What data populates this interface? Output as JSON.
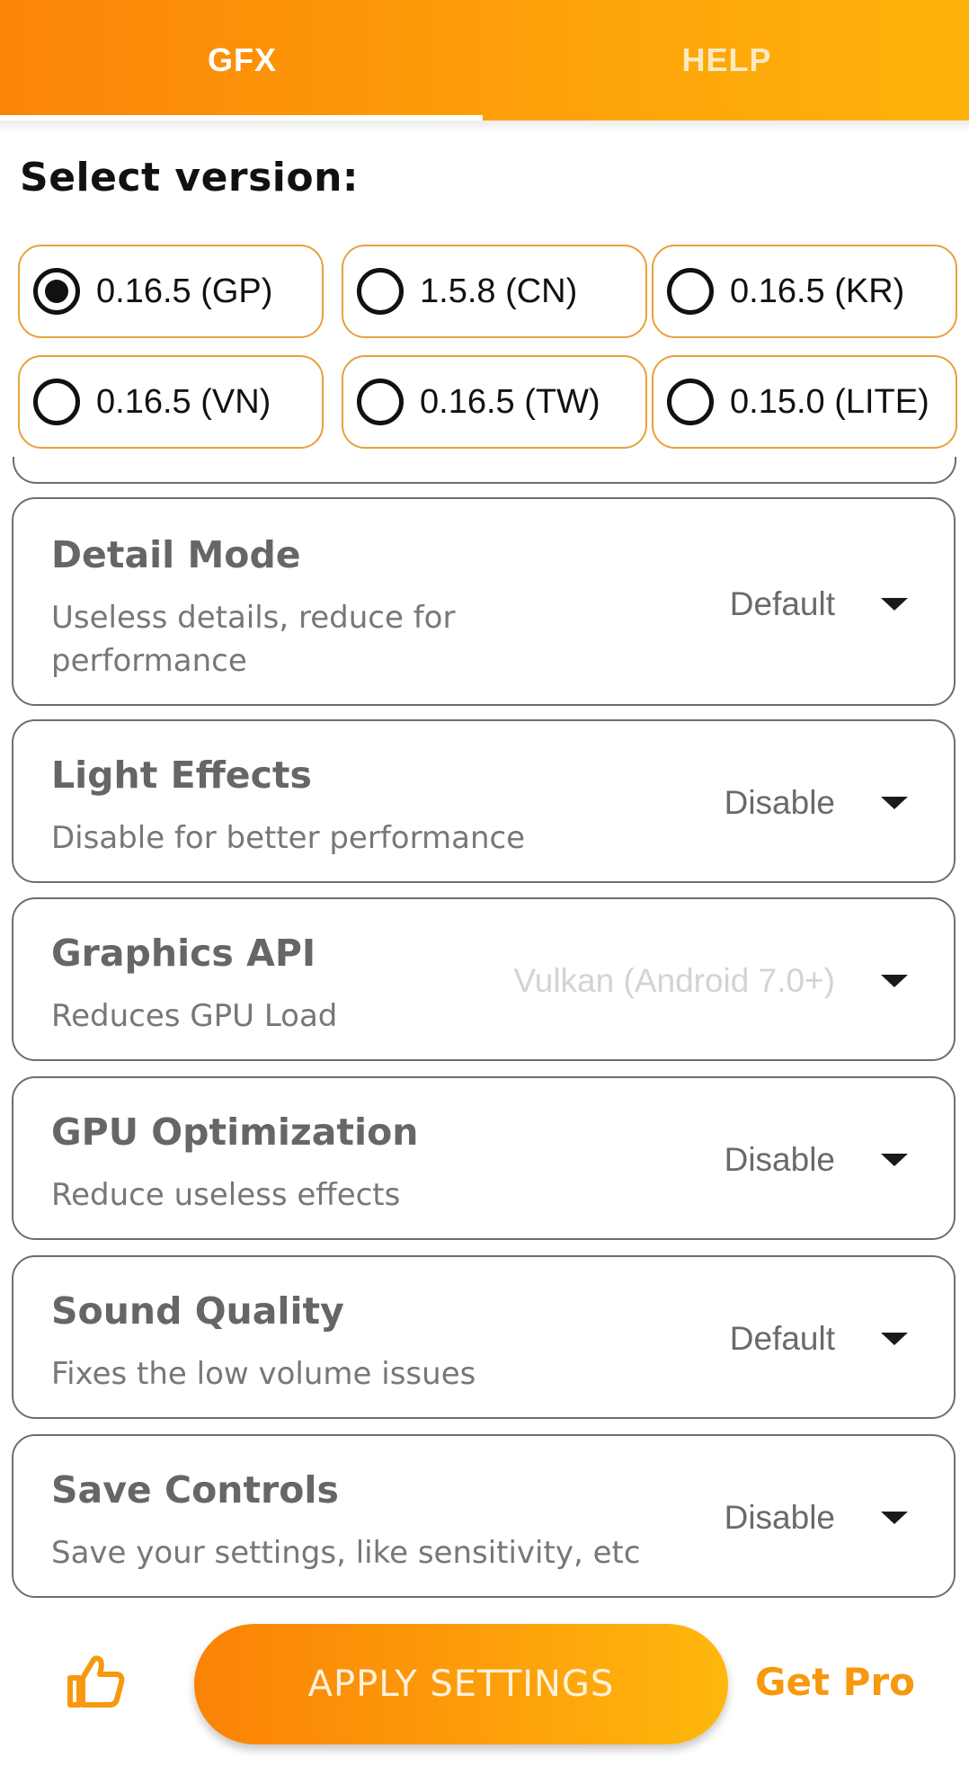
{
  "tabs": [
    {
      "label": "GFX",
      "active": true
    },
    {
      "label": "HELP",
      "active": false
    }
  ],
  "title": "Select version:",
  "versions": [
    {
      "label": "0.16.5 (GP)",
      "selected": true
    },
    {
      "label": "1.5.8 (CN)",
      "selected": false
    },
    {
      "label": "0.16.5 (KR)",
      "selected": false
    },
    {
      "label": "0.16.5 (VN)",
      "selected": false
    },
    {
      "label": "0.16.5 (TW)",
      "selected": false
    },
    {
      "label": "0.15.0 (LITE)",
      "selected": false
    }
  ],
  "settings": [
    {
      "title": "Detail Mode",
      "description": "Useless details, reduce for performance",
      "value": "Default",
      "enabled": true
    },
    {
      "title": "Light Effects",
      "description": "Disable for better performance",
      "value": "Disable",
      "enabled": true
    },
    {
      "title": "Graphics API",
      "description": "Reduces GPU Load",
      "value": "Vulkan (Android 7.0+)",
      "enabled": false
    },
    {
      "title": "GPU Optimization",
      "description": "Reduce useless effects",
      "value": "Disable",
      "enabled": true
    },
    {
      "title": "Sound Quality",
      "description": "Fixes the low volume issues",
      "value": "Default",
      "enabled": true
    },
    {
      "title": "Save Controls",
      "description": "Save your settings, like sensitivity, etc",
      "value": "Disable",
      "enabled": true
    }
  ],
  "bottom": {
    "like_icon": "thumbs-up-icon",
    "apply_label": "APPLY SETTINGS",
    "pro_label": "Get Pro"
  },
  "colors": {
    "accent": "#fd9a0a",
    "accent_start": "#fb8407",
    "accent_end": "#feb30b",
    "card_border": "#6e6e6e",
    "version_border": "#e8a13a"
  }
}
